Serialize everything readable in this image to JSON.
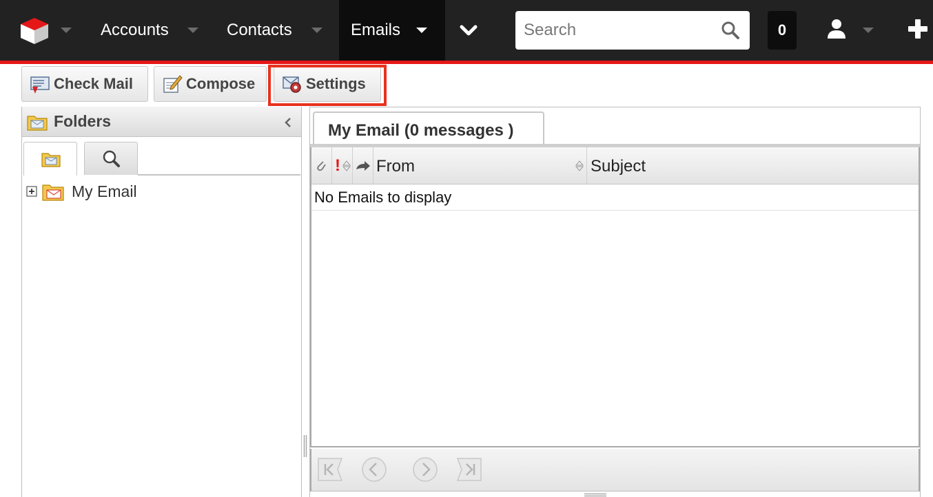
{
  "nav": {
    "logo": "sugarcrm-cube-icon",
    "items": [
      {
        "label": "Accounts"
      },
      {
        "label": "Contacts"
      },
      {
        "label": "Emails",
        "active": true
      }
    ],
    "more_icon": "chevron-down-icon",
    "search": {
      "placeholder": "Search",
      "icon": "search-icon"
    },
    "notifications": {
      "count": "0"
    },
    "user_icon": "user-icon",
    "create_icon": "plus-icon",
    "colors": {
      "bar": "#222222",
      "active": "#0d0d0d",
      "accent_line": "#e61718"
    }
  },
  "toolbar": {
    "buttons": [
      {
        "label": "Check Mail",
        "icon": "check-mail-icon"
      },
      {
        "label": "Compose",
        "icon": "compose-icon"
      },
      {
        "label": "Settings",
        "icon": "settings-icon",
        "highlighted": true
      }
    ],
    "highlight_color": "#e8321f"
  },
  "folders": {
    "title": "Folders",
    "collapse_icon": "chevron-left-icon",
    "tabs": [
      {
        "icon": "folder-icon",
        "active": true
      },
      {
        "icon": "search-icon",
        "active": false
      }
    ],
    "tree": [
      {
        "label": "My Email",
        "icon": "email-folder-icon",
        "expander": "plus-box-icon"
      }
    ]
  },
  "main": {
    "tab_label": "My Email (0 messages )",
    "columns": [
      {
        "icon": "attachment-icon"
      },
      {
        "icon": "priority-icon",
        "text": "!"
      },
      {
        "icon": "reply-status-icon"
      },
      {
        "label": "From"
      },
      {
        "label": "Subject"
      }
    ],
    "empty_message": "No Emails to display",
    "pager": [
      "first-page-icon",
      "previous-page-icon",
      "next-page-icon",
      "last-page-icon"
    ]
  }
}
